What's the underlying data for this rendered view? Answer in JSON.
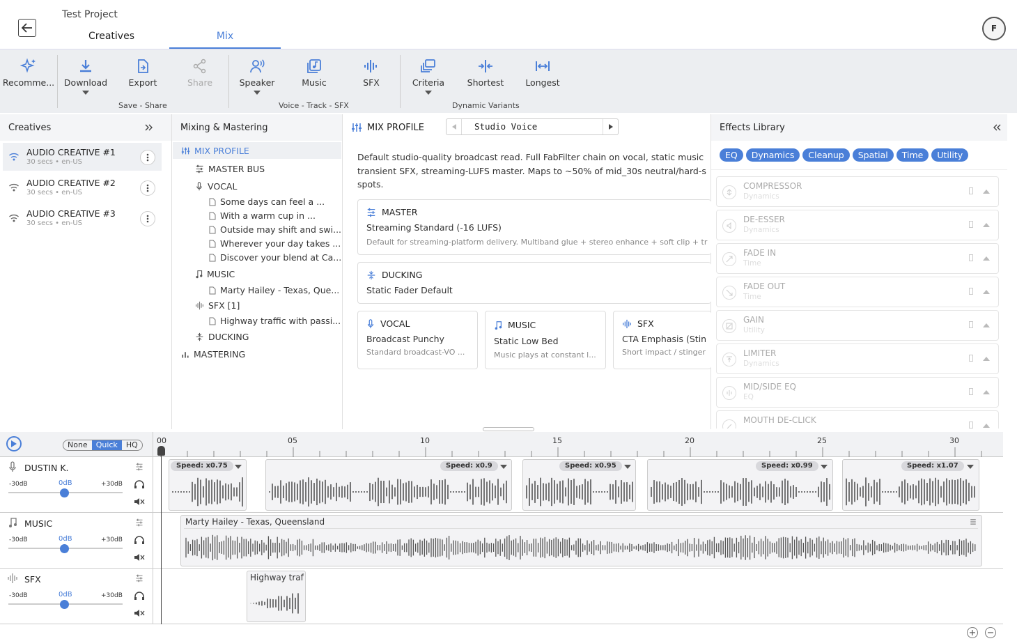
{
  "header": {
    "project_title": "Test Project",
    "tabs": [
      {
        "label": "Creatives"
      },
      {
        "label": "Mix"
      }
    ],
    "active_tab": "Mix",
    "avatar_initial": "F"
  },
  "toolbar": {
    "buttons": [
      {
        "label": "Recomme...",
        "icon": "sparkles-icon"
      },
      {
        "label": "Download",
        "icon": "download-icon"
      },
      {
        "label": "Export",
        "icon": "export-icon"
      },
      {
        "label": "Share",
        "icon": "share-icon"
      },
      {
        "label": "Speaker",
        "icon": "speaker-icon"
      },
      {
        "label": "Music",
        "icon": "music-library-icon"
      },
      {
        "label": "SFX",
        "icon": "waveform-icon"
      },
      {
        "label": "Criteria",
        "icon": "criteria-icon"
      },
      {
        "label": "Shortest",
        "icon": "shortest-icon"
      },
      {
        "label": "Longest",
        "icon": "longest-icon"
      }
    ],
    "groups": [
      {
        "label": "Save - Share"
      },
      {
        "label": "Voice - Track - SFX"
      },
      {
        "label": "Dynamic Variants"
      }
    ]
  },
  "creatives_panel": {
    "title": "Creatives",
    "items": [
      {
        "title": "AUDIO CREATIVE #1",
        "meta": "30 secs • en-US"
      },
      {
        "title": "AUDIO CREATIVE #2",
        "meta": "30 secs • en-US"
      },
      {
        "title": "AUDIO CREATIVE #3",
        "meta": "30 secs • en-US"
      }
    ]
  },
  "mixing_panel": {
    "title": "Mixing & Mastering",
    "tree": {
      "mix_profile": "MIX PROFILE",
      "master_bus": "MASTER BUS",
      "vocal": "VOCAL",
      "vocal_lines": [
        "Some days can feel a ...",
        "With a warm cup in ...",
        "Outside may shift and swi...",
        "Wherever your day takes ...",
        "Discover your blend at Ca..."
      ],
      "music": "MUSIC",
      "music_item": "Marty Hailey - Texas, Que...",
      "sfx": "SFX [1]",
      "sfx_item": "Highway traffic with passi...",
      "ducking": "DUCKING",
      "mastering": "MASTERING"
    }
  },
  "profile_panel": {
    "title": "MIX PROFILE",
    "selected_profile": "Studio Voice",
    "description_lines": [
      "Default studio-quality broadcast read. Full FabFilter chain on vocal, static music",
      "transient SFX, streaming-LUFS master. Maps to ~50% of mid_30s neutral/hard-s",
      "spots."
    ],
    "master": {
      "label": "MASTER",
      "value": "Streaming Standard (-16 LUFS)",
      "desc": "Default for streaming-platform delivery. Multiband glue + stereo enhance + soft clip + tr"
    },
    "ducking": {
      "label": "DUCKING",
      "value": "Static Fader Default"
    },
    "vocal": {
      "label": "VOCAL",
      "value": "Broadcast Punchy",
      "desc": "Standard broadcast-VO ..."
    },
    "music": {
      "label": "MUSIC",
      "value": "Static Low Bed",
      "desc": "Music plays at constant l..."
    },
    "sfx": {
      "label": "SFX",
      "value": "CTA Emphasis (Stin",
      "desc": "Short impact / stinger"
    }
  },
  "effects_panel": {
    "title": "Effects Library",
    "chips": [
      "EQ",
      "Dynamics",
      "Cleanup",
      "Spatial",
      "Time",
      "Utility"
    ],
    "effects": [
      {
        "name": "COMPRESSOR",
        "category": "Dynamics"
      },
      {
        "name": "DE-ESSER",
        "category": "Dynamics"
      },
      {
        "name": "FADE IN",
        "category": "Time"
      },
      {
        "name": "FADE OUT",
        "category": "Time"
      },
      {
        "name": "GAIN",
        "category": "Utility"
      },
      {
        "name": "LIMITER",
        "category": "Dynamics"
      },
      {
        "name": "MID/SIDE EQ",
        "category": "EQ"
      },
      {
        "name": "MOUTH DE-CLICK",
        "category": ""
      }
    ]
  },
  "timeline": {
    "quality": [
      "None",
      "Quick",
      "HQ"
    ],
    "selected_quality": "Quick",
    "ticks": [
      "00",
      "05",
      "10",
      "15",
      "20",
      "25",
      "30"
    ],
    "tracks": [
      {
        "name": "DUSTIN K.",
        "min": "-30dB",
        "value": "0dB",
        "max": "+30dB"
      },
      {
        "name": "MUSIC",
        "min": "-30dB",
        "value": "0dB",
        "max": "+30dB"
      },
      {
        "name": "SFX",
        "min": "-30dB",
        "value": "0dB",
        "max": "+30dB"
      }
    ],
    "vocal_clips": [
      {
        "speed": "Speed: x0.75"
      },
      {
        "speed": "Speed: x0.9"
      },
      {
        "speed": "Speed: x0.95"
      },
      {
        "speed": "Speed: x0.99"
      },
      {
        "speed": "Speed: x1.07"
      }
    ],
    "music_clip": "Marty Hailey - Texas, Queensland",
    "sfx_clip": "Highway traf"
  },
  "colors": {
    "accent": "#4a7fd8",
    "toolbar_bg": "#eceef1"
  }
}
